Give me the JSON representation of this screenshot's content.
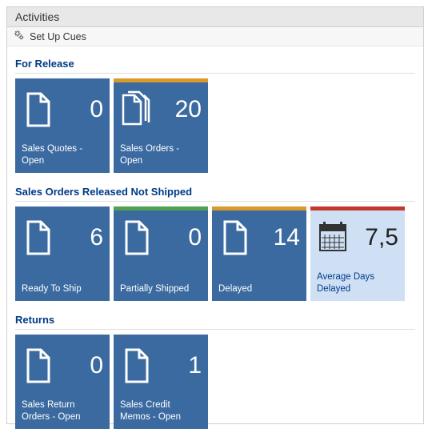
{
  "title": "Activities",
  "toolbar": {
    "setup_label": "Set Up Cues"
  },
  "sections": {
    "for_release": {
      "title": "For Release",
      "sales_quotes": {
        "label": "Sales Quotes - Open",
        "value": "0"
      },
      "sales_orders": {
        "label": "Sales Orders - Open",
        "value": "20"
      }
    },
    "released_not_shipped": {
      "title": "Sales Orders Released Not Shipped",
      "ready": {
        "label": "Ready To Ship",
        "value": "6"
      },
      "partially": {
        "label": "Partially Shipped",
        "value": "0"
      },
      "delayed": {
        "label": "Delayed",
        "value": "14"
      },
      "avg_days": {
        "label": "Average Days Delayed",
        "value": "7,5"
      }
    },
    "returns": {
      "title": "Returns",
      "return_orders": {
        "label": "Sales Return Orders - Open",
        "value": "0"
      },
      "credit_memos": {
        "label": "Sales Credit Memos - Open",
        "value": "1"
      }
    }
  }
}
